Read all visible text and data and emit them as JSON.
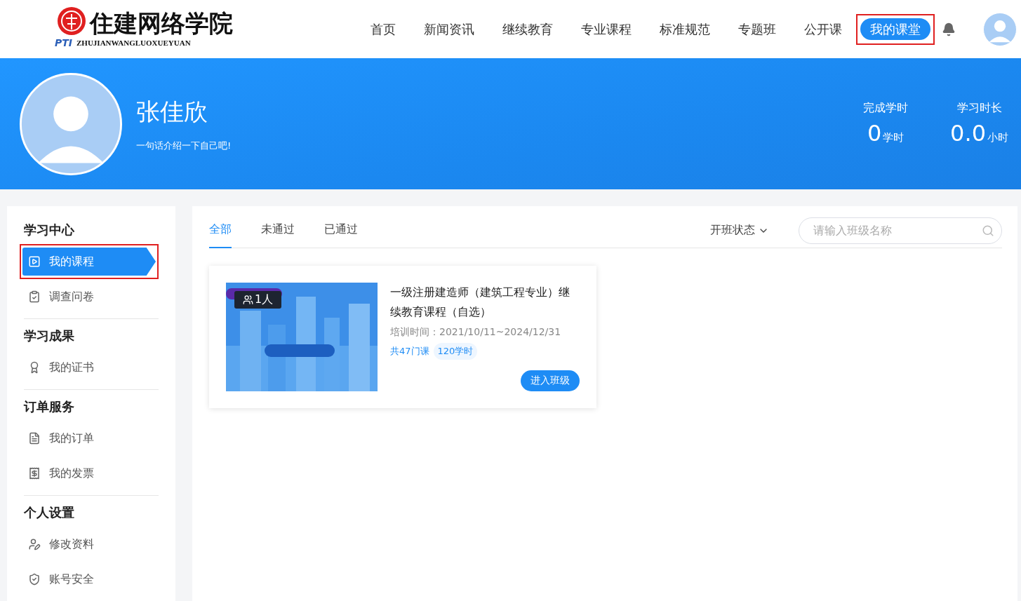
{
  "logo": {
    "name": "住建网络学院",
    "mark": "PTI",
    "pinyin": "ZHUJIANWANGLUOXUEYUAN"
  },
  "nav": [
    {
      "label": "首页",
      "selected": false,
      "highlighted": false
    },
    {
      "label": "新闻资讯",
      "selected": false,
      "highlighted": false
    },
    {
      "label": "继续教育",
      "selected": false,
      "highlighted": false
    },
    {
      "label": "专业课程",
      "selected": false,
      "highlighted": false
    },
    {
      "label": "标准规范",
      "selected": false,
      "highlighted": false
    },
    {
      "label": "专题班",
      "selected": false,
      "highlighted": false
    },
    {
      "label": "公开课",
      "selected": false,
      "highlighted": false
    },
    {
      "label": "我的课堂",
      "selected": true,
      "highlighted": true
    }
  ],
  "profile": {
    "name": "张佳欣",
    "bio": "一句话介绍一下自己吧!",
    "stats": [
      {
        "label": "完成学时",
        "value": "0",
        "unit": "学时"
      },
      {
        "label": "学习时长",
        "value": "0.0",
        "unit": "小时"
      }
    ]
  },
  "sidebar": [
    {
      "title": "学习中心",
      "items": [
        {
          "label": "我的课程",
          "selected": true,
          "highlighted": true
        },
        {
          "label": "调查问卷",
          "selected": false,
          "highlighted": false
        }
      ]
    },
    {
      "title": "学习成果",
      "items": [
        {
          "label": "我的证书",
          "selected": false,
          "highlighted": false
        }
      ]
    },
    {
      "title": "订单服务",
      "items": [
        {
          "label": "我的订单",
          "selected": false,
          "highlighted": false
        },
        {
          "label": "我的发票",
          "selected": false,
          "highlighted": false
        }
      ]
    },
    {
      "title": "个人设置",
      "items": [
        {
          "label": "修改资料",
          "selected": false,
          "highlighted": false
        },
        {
          "label": "账号安全",
          "selected": false,
          "highlighted": false
        }
      ]
    }
  ],
  "tabs": [
    {
      "label": "全部",
      "selected": true
    },
    {
      "label": "未通过",
      "selected": false
    },
    {
      "label": "已通过",
      "selected": false
    }
  ],
  "filter": {
    "label": "开班状态"
  },
  "search": {
    "placeholder": "请输入班级名称"
  },
  "courses": [
    {
      "members": "1人",
      "title": "一级注册建造师（建筑工程专业）继续教育课程（自选）",
      "period": "培训时间：2021/10/11~2024/12/31",
      "count": "共47门课",
      "hours": "120学时",
      "action": "进入班级"
    }
  ]
}
